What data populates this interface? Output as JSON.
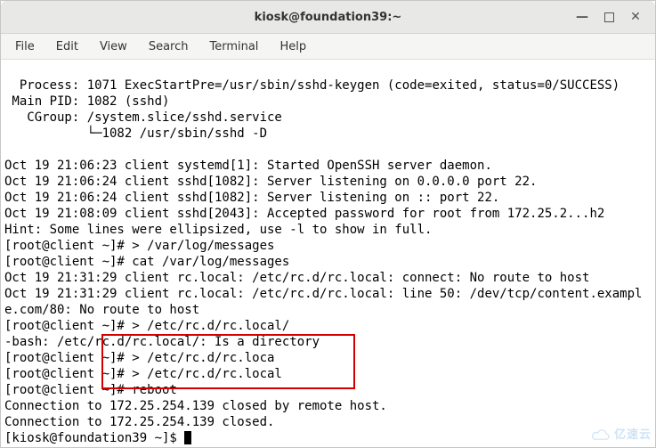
{
  "titlebar": {
    "title": "kiosk@foundation39:~"
  },
  "menu": {
    "file": "File",
    "edit": "Edit",
    "view": "View",
    "search": "Search",
    "terminal": "Terminal",
    "help": "Help"
  },
  "lines": {
    "l1": "  Process: 1071 ExecStartPre=/usr/sbin/sshd-keygen (code=exited, status=0/SUCCESS)",
    "l2": " Main PID: 1082 (sshd)",
    "l3": "   CGroup: /system.slice/sshd.service",
    "l4": "           └─1082 /usr/sbin/sshd -D",
    "l5": "",
    "l6": "Oct 19 21:06:23 client systemd[1]: Started OpenSSH server daemon.",
    "l7": "Oct 19 21:06:24 client sshd[1082]: Server listening on 0.0.0.0 port 22.",
    "l8": "Oct 19 21:06:24 client sshd[1082]: Server listening on :: port 22.",
    "l9": "Oct 19 21:08:09 client sshd[2043]: Accepted password for root from 172.25.2...h2",
    "l10": "Hint: Some lines were ellipsized, use -l to show in full.",
    "l11": "[root@client ~]# > /var/log/messages",
    "l12": "[root@client ~]# cat /var/log/messages",
    "l13": "Oct 19 21:31:29 client rc.local: /etc/rc.d/rc.local: connect: No route to host",
    "l14": "Oct 19 21:31:29 client rc.local: /etc/rc.d/rc.local: line 50: /dev/tcp/content.example.com/80: No route to host",
    "l15": "[root@client ~]# > /etc/rc.d/rc.local/",
    "l16": "-bash: /etc/rc.d/rc.local/: Is a directory",
    "l17": "[root@client ~]# > /etc/rc.d/rc.loca",
    "l18": "[root@client ~]# > /etc/rc.d/rc.local",
    "l19": "[root@client ~]# reboot",
    "l20": "Connection to 172.25.254.139 closed by remote host.",
    "l21": "Connection to 172.25.254.139 closed.",
    "l22": "[kiosk@foundation39 ~]$ "
  },
  "watermark": {
    "text": "亿速云"
  }
}
